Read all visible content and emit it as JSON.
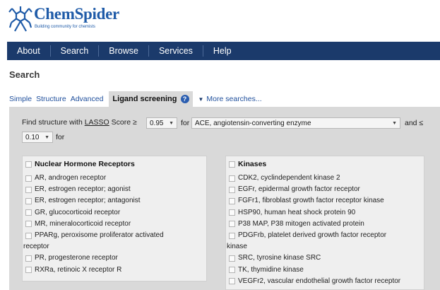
{
  "logo": {
    "name": "ChemSpider",
    "tagline": "Building community for chemists",
    "brand_color": "#1f5ba8"
  },
  "nav": {
    "items": [
      "About",
      "Search",
      "Browse",
      "Services",
      "Help"
    ],
    "bg_color": "#1b3a6b"
  },
  "page_title": "Search",
  "tabs": {
    "items": [
      "Simple",
      "Structure",
      "Advanced"
    ],
    "active": "Ligand screening",
    "more": "More searches..."
  },
  "form": {
    "find_prefix": "Find structure with ",
    "lasso": "LASSO",
    "score_label": " Score ≥",
    "min_score": "0.95",
    "for1": "for",
    "target": "ACE, angiotensin-converting enzyme",
    "and_le": "and ≤",
    "max_score": "0.10",
    "for2": "for"
  },
  "groups": {
    "left": {
      "title": "Nuclear Hormone Receptors",
      "items": [
        "AR, androgen receptor",
        "ER, estrogen receptor; agonist",
        "ER, estrogen receptor; antagonist",
        "GR, glucocorticoid receptor",
        "MR, mineralocorticoid receptor",
        "PPARg, peroxisome proliferator activated",
        "receptor",
        "PR, progesterone receptor",
        "RXRa, retinoic X receptor R"
      ]
    },
    "right": {
      "title": "Kinases",
      "items": [
        "CDK2, cyclindependent kinase 2",
        "EGFr, epidermal growth factor receptor",
        "FGFr1, fibroblast growth factor receptor kinase",
        "HSP90, human heat shock protein 90",
        "P38 MAP, P38 mitogen activated protein",
        "PDGFrb, platelet derived growth factor receptor",
        "kinase",
        "SRC, tyrosine kinase SRC",
        "TK, thymidine kinase",
        "VEGFr2, vascular endothelial growth factor receptor"
      ]
    }
  }
}
